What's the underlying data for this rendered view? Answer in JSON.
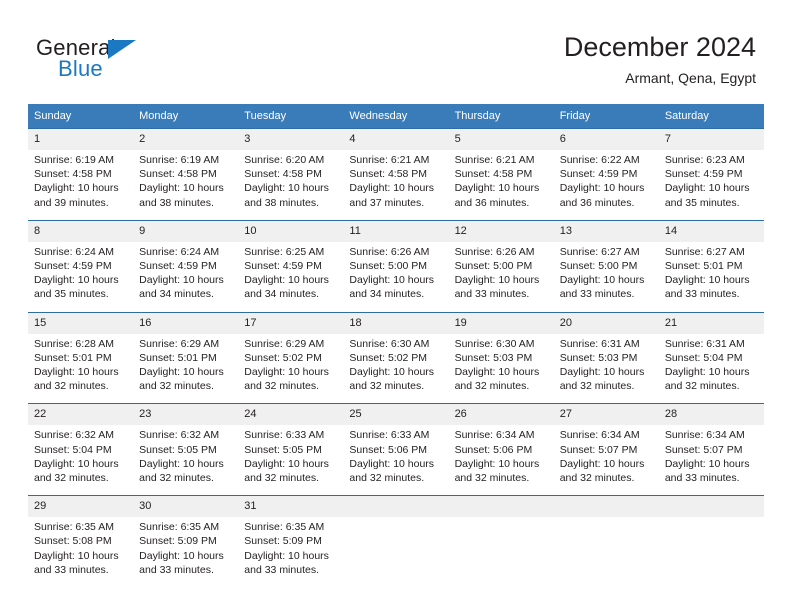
{
  "brand": {
    "name_top": "General",
    "name_bottom": "Blue",
    "accent_color": "#1b79c3"
  },
  "header": {
    "title": "December 2024",
    "subtitle": "Armant, Qena, Egypt"
  },
  "theme": {
    "header_bg": "#3a7cb9",
    "row_border": "#2d6ca5",
    "daynum_bg": "#f0f0f0",
    "text": "#231f20"
  },
  "weekday_headers": [
    "Sunday",
    "Monday",
    "Tuesday",
    "Wednesday",
    "Thursday",
    "Friday",
    "Saturday"
  ],
  "weeks": [
    [
      {
        "day": "1",
        "sunrise": "Sunrise: 6:19 AM",
        "sunset": "Sunset: 4:58 PM",
        "daylight_line1": "Daylight: 10 hours",
        "daylight_line2": "and 39 minutes."
      },
      {
        "day": "2",
        "sunrise": "Sunrise: 6:19 AM",
        "sunset": "Sunset: 4:58 PM",
        "daylight_line1": "Daylight: 10 hours",
        "daylight_line2": "and 38 minutes."
      },
      {
        "day": "3",
        "sunrise": "Sunrise: 6:20 AM",
        "sunset": "Sunset: 4:58 PM",
        "daylight_line1": "Daylight: 10 hours",
        "daylight_line2": "and 38 minutes."
      },
      {
        "day": "4",
        "sunrise": "Sunrise: 6:21 AM",
        "sunset": "Sunset: 4:58 PM",
        "daylight_line1": "Daylight: 10 hours",
        "daylight_line2": "and 37 minutes."
      },
      {
        "day": "5",
        "sunrise": "Sunrise: 6:21 AM",
        "sunset": "Sunset: 4:58 PM",
        "daylight_line1": "Daylight: 10 hours",
        "daylight_line2": "and 36 minutes."
      },
      {
        "day": "6",
        "sunrise": "Sunrise: 6:22 AM",
        "sunset": "Sunset: 4:59 PM",
        "daylight_line1": "Daylight: 10 hours",
        "daylight_line2": "and 36 minutes."
      },
      {
        "day": "7",
        "sunrise": "Sunrise: 6:23 AM",
        "sunset": "Sunset: 4:59 PM",
        "daylight_line1": "Daylight: 10 hours",
        "daylight_line2": "and 35 minutes."
      }
    ],
    [
      {
        "day": "8",
        "sunrise": "Sunrise: 6:24 AM",
        "sunset": "Sunset: 4:59 PM",
        "daylight_line1": "Daylight: 10 hours",
        "daylight_line2": "and 35 minutes."
      },
      {
        "day": "9",
        "sunrise": "Sunrise: 6:24 AM",
        "sunset": "Sunset: 4:59 PM",
        "daylight_line1": "Daylight: 10 hours",
        "daylight_line2": "and 34 minutes."
      },
      {
        "day": "10",
        "sunrise": "Sunrise: 6:25 AM",
        "sunset": "Sunset: 4:59 PM",
        "daylight_line1": "Daylight: 10 hours",
        "daylight_line2": "and 34 minutes."
      },
      {
        "day": "11",
        "sunrise": "Sunrise: 6:26 AM",
        "sunset": "Sunset: 5:00 PM",
        "daylight_line1": "Daylight: 10 hours",
        "daylight_line2": "and 34 minutes."
      },
      {
        "day": "12",
        "sunrise": "Sunrise: 6:26 AM",
        "sunset": "Sunset: 5:00 PM",
        "daylight_line1": "Daylight: 10 hours",
        "daylight_line2": "and 33 minutes."
      },
      {
        "day": "13",
        "sunrise": "Sunrise: 6:27 AM",
        "sunset": "Sunset: 5:00 PM",
        "daylight_line1": "Daylight: 10 hours",
        "daylight_line2": "and 33 minutes."
      },
      {
        "day": "14",
        "sunrise": "Sunrise: 6:27 AM",
        "sunset": "Sunset: 5:01 PM",
        "daylight_line1": "Daylight: 10 hours",
        "daylight_line2": "and 33 minutes."
      }
    ],
    [
      {
        "day": "15",
        "sunrise": "Sunrise: 6:28 AM",
        "sunset": "Sunset: 5:01 PM",
        "daylight_line1": "Daylight: 10 hours",
        "daylight_line2": "and 32 minutes."
      },
      {
        "day": "16",
        "sunrise": "Sunrise: 6:29 AM",
        "sunset": "Sunset: 5:01 PM",
        "daylight_line1": "Daylight: 10 hours",
        "daylight_line2": "and 32 minutes."
      },
      {
        "day": "17",
        "sunrise": "Sunrise: 6:29 AM",
        "sunset": "Sunset: 5:02 PM",
        "daylight_line1": "Daylight: 10 hours",
        "daylight_line2": "and 32 minutes."
      },
      {
        "day": "18",
        "sunrise": "Sunrise: 6:30 AM",
        "sunset": "Sunset: 5:02 PM",
        "daylight_line1": "Daylight: 10 hours",
        "daylight_line2": "and 32 minutes."
      },
      {
        "day": "19",
        "sunrise": "Sunrise: 6:30 AM",
        "sunset": "Sunset: 5:03 PM",
        "daylight_line1": "Daylight: 10 hours",
        "daylight_line2": "and 32 minutes."
      },
      {
        "day": "20",
        "sunrise": "Sunrise: 6:31 AM",
        "sunset": "Sunset: 5:03 PM",
        "daylight_line1": "Daylight: 10 hours",
        "daylight_line2": "and 32 minutes."
      },
      {
        "day": "21",
        "sunrise": "Sunrise: 6:31 AM",
        "sunset": "Sunset: 5:04 PM",
        "daylight_line1": "Daylight: 10 hours",
        "daylight_line2": "and 32 minutes."
      }
    ],
    [
      {
        "day": "22",
        "sunrise": "Sunrise: 6:32 AM",
        "sunset": "Sunset: 5:04 PM",
        "daylight_line1": "Daylight: 10 hours",
        "daylight_line2": "and 32 minutes."
      },
      {
        "day": "23",
        "sunrise": "Sunrise: 6:32 AM",
        "sunset": "Sunset: 5:05 PM",
        "daylight_line1": "Daylight: 10 hours",
        "daylight_line2": "and 32 minutes."
      },
      {
        "day": "24",
        "sunrise": "Sunrise: 6:33 AM",
        "sunset": "Sunset: 5:05 PM",
        "daylight_line1": "Daylight: 10 hours",
        "daylight_line2": "and 32 minutes."
      },
      {
        "day": "25",
        "sunrise": "Sunrise: 6:33 AM",
        "sunset": "Sunset: 5:06 PM",
        "daylight_line1": "Daylight: 10 hours",
        "daylight_line2": "and 32 minutes."
      },
      {
        "day": "26",
        "sunrise": "Sunrise: 6:34 AM",
        "sunset": "Sunset: 5:06 PM",
        "daylight_line1": "Daylight: 10 hours",
        "daylight_line2": "and 32 minutes."
      },
      {
        "day": "27",
        "sunrise": "Sunrise: 6:34 AM",
        "sunset": "Sunset: 5:07 PM",
        "daylight_line1": "Daylight: 10 hours",
        "daylight_line2": "and 32 minutes."
      },
      {
        "day": "28",
        "sunrise": "Sunrise: 6:34 AM",
        "sunset": "Sunset: 5:07 PM",
        "daylight_line1": "Daylight: 10 hours",
        "daylight_line2": "and 33 minutes."
      }
    ],
    [
      {
        "day": "29",
        "sunrise": "Sunrise: 6:35 AM",
        "sunset": "Sunset: 5:08 PM",
        "daylight_line1": "Daylight: 10 hours",
        "daylight_line2": "and 33 minutes."
      },
      {
        "day": "30",
        "sunrise": "Sunrise: 6:35 AM",
        "sunset": "Sunset: 5:09 PM",
        "daylight_line1": "Daylight: 10 hours",
        "daylight_line2": "and 33 minutes."
      },
      {
        "day": "31",
        "sunrise": "Sunrise: 6:35 AM",
        "sunset": "Sunset: 5:09 PM",
        "daylight_line1": "Daylight: 10 hours",
        "daylight_line2": "and 33 minutes."
      },
      {
        "day": "",
        "sunrise": "",
        "sunset": "",
        "daylight_line1": "",
        "daylight_line2": ""
      },
      {
        "day": "",
        "sunrise": "",
        "sunset": "",
        "daylight_line1": "",
        "daylight_line2": ""
      },
      {
        "day": "",
        "sunrise": "",
        "sunset": "",
        "daylight_line1": "",
        "daylight_line2": ""
      },
      {
        "day": "",
        "sunrise": "",
        "sunset": "",
        "daylight_line1": "",
        "daylight_line2": ""
      }
    ]
  ]
}
